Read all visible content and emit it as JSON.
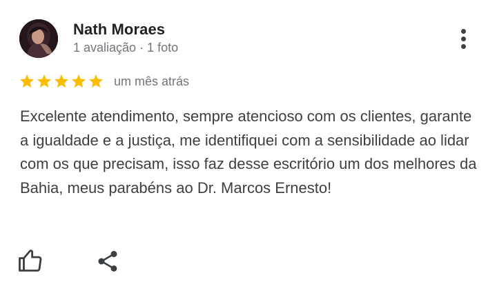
{
  "review": {
    "reviewer_name": "Nath Moraes",
    "reviewer_meta": "1 avaliação · 1 foto",
    "rating": 5,
    "rating_max": 5,
    "time_ago": "um mês atrás",
    "text": "Excelente atendimento, sempre atencioso com os clientes, garante a igualdade e a justiça, me identifiquei com a sensibilidade ao lidar com os que precisam, isso faz desse escritório um dos melhores da Bahia, meus parabéns ao Dr. Marcos Ernesto!"
  },
  "icons": {
    "more": "more-vert-icon",
    "star": "star-icon",
    "like": "thumbs-up-icon",
    "share": "share-icon"
  },
  "colors": {
    "star": "#fbbc04",
    "text": "#3c4043",
    "muted": "#70757a",
    "name": "#202124"
  }
}
